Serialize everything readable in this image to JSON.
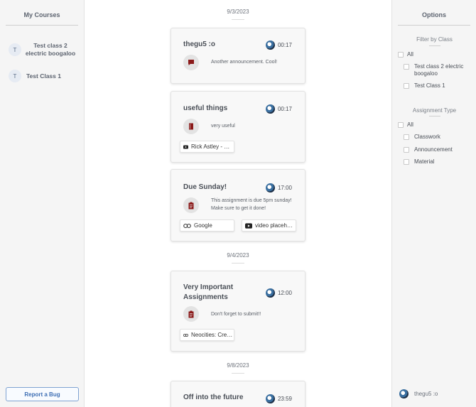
{
  "left_sidebar": {
    "title": "My Courses",
    "courses": [
      {
        "initial": "T",
        "name": "Test class 2 electric boogaloo"
      },
      {
        "initial": "T",
        "name": "Test Class 1"
      }
    ],
    "report_bug_label": "Report a Bug"
  },
  "right_sidebar": {
    "title": "Options",
    "filter_heading": "Filter by Class",
    "filter_options": [
      "All",
      "Test class 2 electric boogaloo",
      "Test Class 1"
    ],
    "type_heading": "Assignment Type",
    "type_options": [
      "All",
      "Classwork",
      "Announcement",
      "Material"
    ],
    "user_name": "thegu5 :o"
  },
  "feed": {
    "dates": [
      "9/3/2023",
      "9/4/2023",
      "9/8/2023"
    ],
    "posts": [
      {
        "title": "thegu5 :o",
        "time": "00:17",
        "type_icon": "announcement-icon",
        "description": "Another announcement. Cool!",
        "attachments": []
      },
      {
        "title": "useful things",
        "time": "00:17",
        "type_icon": "material-icon",
        "description": "very useful",
        "attachments": [
          {
            "icon": "youtube-icon",
            "label": "Rick Astley - Never Gonna Give You Up"
          }
        ]
      },
      {
        "title": "Due Sunday!",
        "time": "17:00",
        "type_icon": "assignment-icon",
        "description_lines": [
          "This assignment is due 5pm sunday!",
          "Make sure to get it done!"
        ],
        "attachments": [
          {
            "icon": "link-icon",
            "label": "Google"
          },
          {
            "icon": "youtube-icon",
            "label": "video placeholder"
          }
        ]
      },
      {
        "title": "Very Important Assignments",
        "time": "12:00",
        "type_icon": "assignment-icon",
        "description": "Don't forget to submit!!",
        "attachments": [
          {
            "icon": "link-icon",
            "label": "Neocities: Create your own free website"
          }
        ]
      },
      {
        "title": "Off into the future",
        "time": "23:59"
      }
    ]
  },
  "colors": {
    "accent_red": "#8b1a1a",
    "link_blue": "#3d6eb4"
  }
}
